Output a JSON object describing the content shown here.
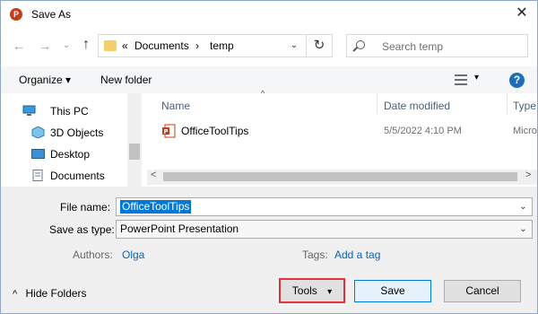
{
  "window": {
    "title": "Save As",
    "close_glyph": "✕",
    "app_icon": "powerpoint-icon"
  },
  "nav": {
    "back_glyph": "←",
    "forward_glyph": "→",
    "up_glyph": "↑",
    "breadcrumb_prefix": "«",
    "breadcrumb": [
      "Documents",
      "temp"
    ],
    "crumb_separator": "›",
    "address_dropdown_glyph": "⌄",
    "refresh_glyph": "↻",
    "search_placeholder": "Search temp"
  },
  "commandbar": {
    "organize": "Organize ▾",
    "new_folder": "New folder",
    "view_dropdown_glyph": "▾",
    "help": "?"
  },
  "tree": {
    "items": [
      {
        "label": "This PC",
        "icon": "pc-icon"
      },
      {
        "label": "3D Objects",
        "icon": "3d-objects-icon"
      },
      {
        "label": "Desktop",
        "icon": "desktop-icon"
      },
      {
        "label": "Documents",
        "icon": "documents-icon"
      }
    ]
  },
  "list": {
    "columns": [
      "Name",
      "Date modified",
      "Type"
    ],
    "sort_glyph": "^",
    "rows": [
      {
        "name": "OfficeToolTips",
        "date": "5/5/2022 4:10 PM",
        "type": "Micro"
      }
    ],
    "scroll_left_glyph": "<",
    "scroll_right_glyph": ">"
  },
  "form": {
    "file_name_label": "File name:",
    "file_name_value": "OfficeToolTips",
    "save_as_type_label": "Save as type:",
    "save_as_type_value": "PowerPoint Presentation",
    "authors_label": "Authors:",
    "authors_value": "Olga",
    "tags_label": "Tags:",
    "tags_value": "Add a tag",
    "combo_glyph": "⌄"
  },
  "footer": {
    "hide_folders": "Hide Folders",
    "hide_glyph": "^",
    "tools": "Tools",
    "tools_glyph": "▾",
    "save": "Save",
    "cancel": "Cancel"
  }
}
